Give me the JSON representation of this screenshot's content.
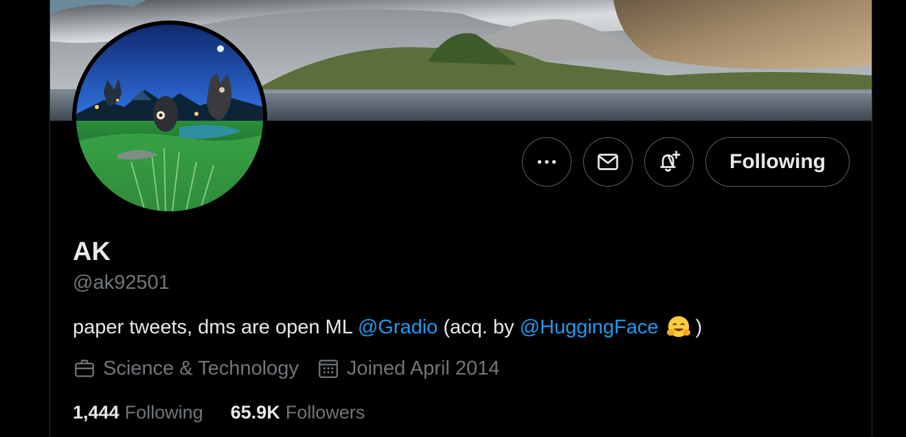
{
  "profile": {
    "name": "AK",
    "handle": "@ak92501",
    "bio": {
      "text_before": "paper tweets, dms are open ML ",
      "link1": "@Gradio",
      "text_middle": " (acq. by ",
      "link2": "@HuggingFace",
      "text_after": ")",
      "emoji": "hugging-face-emoji"
    },
    "category": "Science & Technology",
    "joined": "Joined April 2014",
    "following_count": "1,444",
    "following_label": "Following",
    "followers_count": "65.9K",
    "followers_label": "Followers"
  },
  "actions": {
    "more_icon": "more-icon",
    "message_icon": "mail-icon",
    "notify_icon": "bell-plus-icon",
    "follow_label": "Following"
  },
  "colors": {
    "background": "#000000",
    "text_primary": "#e7e9ea",
    "text_secondary": "#71767b",
    "link": "#1d9bf0",
    "border": "#536471"
  }
}
